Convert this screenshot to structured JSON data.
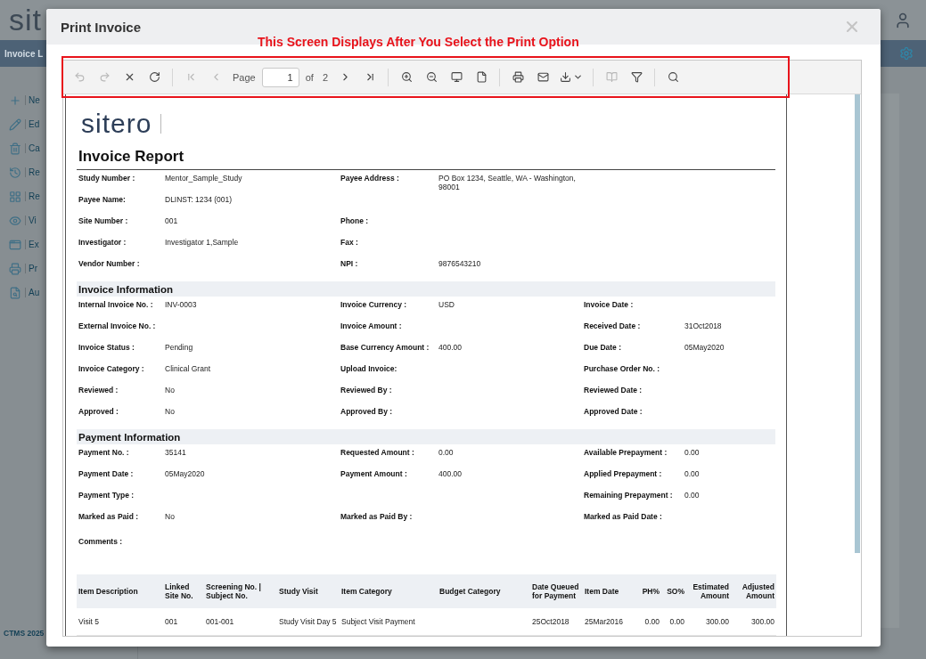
{
  "background": {
    "logo": "sit",
    "nav_title": "Invoice L",
    "sidebar": [
      {
        "label": "Ne"
      },
      {
        "label": "Ed"
      },
      {
        "label": "Ca"
      },
      {
        "label": "Re"
      },
      {
        "label": "Re"
      },
      {
        "label": "Vi"
      },
      {
        "label": "Ex"
      },
      {
        "label": "Pr"
      },
      {
        "label": "Au"
      }
    ],
    "footer": "CTMS 2025"
  },
  "modal": {
    "title": "Print Invoice",
    "annotation": "This Screen Displays After You Select the Print Option",
    "toolbar": {
      "buttons": [
        {
          "disabled": true
        },
        {
          "disabled": true
        },
        {
          "disabled": false
        },
        {
          "disabled": false
        },
        {
          "disabled": true
        },
        {
          "disabled": true
        },
        {
          "disabled": false
        },
        {
          "disabled": false
        },
        {
          "disabled": false
        },
        {
          "disabled": false
        },
        {
          "disabled": false
        },
        {
          "disabled": false
        },
        {
          "disabled": false
        },
        {
          "disabled": false
        },
        {
          "disabled": false
        },
        {
          "disabled": true
        },
        {
          "disabled": false
        },
        {
          "disabled": false
        }
      ],
      "page_label": "Page",
      "page_value": "1",
      "of_label": "of",
      "page_count": "2"
    },
    "report": {
      "logo": "sitero",
      "title": "Invoice Report",
      "sections": [
        {
          "rows": [
            {
              "left": {
                "label": "Study Number :",
                "value": "Mentor_Sample_Study"
              },
              "middle": {
                "label": "Payee Address :",
                "value": "PO Box 1234, Seattle, WA - Washington, 98001"
              }
            },
            {
              "left": {
                "label": "Payee Name:",
                "value": "DLINST: 1234 (001)"
              }
            },
            {
              "left": {
                "label": "Site Number :",
                "value": "001"
              },
              "middle": {
                "label": "Phone :"
              }
            },
            {
              "left": {
                "label": "Investigator :",
                "value": "Investigator 1,Sample"
              },
              "middle": {
                "label": "Fax :"
              }
            },
            {
              "left": {
                "label": "Vendor Number :"
              },
              "middle": {
                "label": "NPI :",
                "value": "9876543210"
              }
            }
          ]
        },
        {
          "title": "Invoice Information",
          "rows": [
            {
              "left": {
                "label": "Internal Invoice No. :",
                "value": "INV-0003"
              },
              "middle": {
                "label": "Invoice Currency :",
                "value": "USD"
              },
              "right": {
                "label": "Invoice Date :"
              }
            },
            {
              "left": {
                "label": "External Invoice No. :"
              },
              "middle": {
                "label": "Invoice Amount :"
              },
              "right": {
                "label": "Received Date :",
                "value": "31Oct2018"
              }
            },
            {
              "left": {
                "label": "Invoice Status :",
                "value": "Pending"
              },
              "middle": {
                "label": "Base Currency Amount :",
                "value": "400.00"
              },
              "right": {
                "label": "Due Date :",
                "value": "05May2020"
              }
            },
            {
              "left": {
                "label": "Invoice Category :",
                "value": "Clinical Grant"
              },
              "middle": {
                "label": "Upload Invoice:"
              },
              "right": {
                "label": "Purchase Order No. :"
              }
            },
            {
              "left": {
                "label": "Reviewed :",
                "value": "No"
              },
              "middle": {
                "label": "Reviewed By :"
              },
              "right": {
                "label": "Reviewed Date :"
              }
            },
            {
              "left": {
                "label": "Approved :",
                "value": "No"
              },
              "middle": {
                "label": "Approved By :"
              },
              "right": {
                "label": "Approved Date :"
              }
            }
          ]
        },
        {
          "title": "Payment Information",
          "rows": [
            {
              "left": {
                "label": "Payment No. :",
                "value": "35141"
              },
              "middle": {
                "label": "Requested Amount :",
                "value": "0.00"
              },
              "right": {
                "label": "Available Prepayment :",
                "value": "0.00"
              }
            },
            {
              "left": {
                "label": "Payment Date :",
                "value": "05May2020"
              },
              "middle": {
                "label": "Payment Amount :",
                "value": "400.00"
              },
              "right": {
                "label": "Applied Prepayment :",
                "value": "0.00"
              }
            },
            {
              "left": {
                "label": "Payment Type :"
              },
              "right": {
                "label": "Remaining Prepayment :",
                "value": "0.00"
              }
            },
            {
              "left": {
                "label": "Marked as Paid :",
                "value": "No"
              },
              "middle": {
                "label": "Marked as Paid By :"
              },
              "right": {
                "label": "Marked as Paid Date :"
              }
            },
            {
              "left": {
                "label": "Comments :"
              }
            }
          ]
        }
      ],
      "table": {
        "columns": [
          {
            "label": "Item Description"
          },
          {
            "label": "Linked Site No."
          },
          {
            "label": "Screening No. | Subject No."
          },
          {
            "label": "Study Visit"
          },
          {
            "label": "Item Category"
          },
          {
            "label": "Budget Category"
          },
          {
            "label": "Date Queued for Payment"
          },
          {
            "label": "Item Date"
          },
          {
            "label": "PH%"
          },
          {
            "label": "SO%"
          },
          {
            "label": "Estimated Amount"
          },
          {
            "label": "Adjusted Amount"
          }
        ],
        "rows": [
          {
            "cells": [
              "Visit 5",
              "001",
              "001-001",
              "Study Visit Day 5",
              "Subject Visit Payment",
              "",
              "25Oct2018",
              "25Mar2016",
              "0.00",
              "0.00",
              "300.00",
              "300.00"
            ]
          }
        ]
      }
    }
  }
}
